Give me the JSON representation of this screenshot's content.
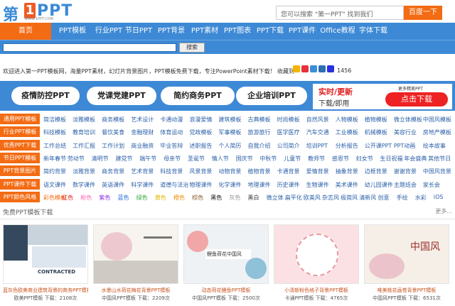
{
  "header": {
    "logo_prefix": "第",
    "logo_num": "1",
    "logo_text": "PPT",
    "logo_url": "WWW.1PPT.COM",
    "search_placeholder": "您可以搜索 \"第一PPT\" 找到我们",
    "search_button": "百度一下"
  },
  "nav": {
    "items": [
      "首页",
      "PPT模板",
      "行业PPT",
      "节日PPT",
      "PPT背景",
      "PPT素材",
      "PPT图表",
      "PPT下载",
      "PPT课件",
      "Office教程",
      "字体下载"
    ]
  },
  "site_search": {
    "button": "搜索"
  },
  "welcome": {
    "text": "欢迎进入第一PPT模板网，海量PPT素材，幻灯片背景图片，PPT模板免费下载，专注PowerPoint素材下载！",
    "share_label": "收藏到",
    "count": "1456"
  },
  "banner": {
    "pills": [
      "疫情防控PPT",
      "党课党建PPT",
      "简约商务PPT",
      "企业培训PPT"
    ],
    "promo_title": "实时/更新",
    "promo_sub": "下载/即用",
    "promo_more": "更多精美PPT",
    "promo_btn": "点击下载"
  },
  "categories": [
    {
      "label": "通用PPT模板",
      "links": [
        "简洁模板",
        "淡雅模板",
        "商务模板",
        "艺术设计",
        "卡通动漫",
        "浪漫爱情",
        "建筑模板",
        "古典模板",
        "时尚模板",
        "自然风景",
        "人物模板",
        "植物模板",
        "微立体模板",
        "中国风模板"
      ]
    },
    {
      "label": "行业PPT模板",
      "links": [
        "科技模板",
        "教育培训",
        "餐饮美食",
        "金融理财",
        "体育运动",
        "党政模板",
        "军事模板",
        "旅游旅行",
        "医学医疗",
        "汽车交通",
        "工业模板",
        "机械模板",
        "美容行业",
        "房地产模板"
      ]
    },
    {
      "label": "优秀PPT下载",
      "links": [
        "工作总结",
        "工作汇报",
        "工作计划",
        "商业融资",
        "毕业答辩",
        "述职报告",
        "个人简历",
        "自我介绍",
        "公司简介",
        "培训PPT",
        "分析报告",
        "公开课PPT",
        "PPT动画",
        "绘本故事"
      ]
    },
    {
      "label": "节日PPT模板",
      "links": [
        "新年春节",
        "劳动节",
        "清明节",
        "建党节",
        "端午节",
        "母亲节",
        "圣诞节",
        "情人节",
        "国庆节",
        "中秋节",
        "儿童节",
        "教师节",
        "感恩节",
        "妇女节",
        "生日祝福",
        "年会盛典",
        "其他节日"
      ]
    },
    {
      "label": "PPT背景图片",
      "links": [
        "简约背景",
        "淡雅背景",
        "商务背景",
        "艺术背景",
        "科技背景",
        "风景背景",
        "动物背景",
        "植物背景",
        "卡通背景",
        "爱情背景",
        "抽象背景",
        "边框背景",
        "谢谢背景",
        "中国风背景"
      ]
    },
    {
      "label": "PPT课件下载",
      "links": [
        "语文课件",
        "数学课件",
        "英语课件",
        "科学课件",
        "道德与法治",
        "物理课件",
        "化学课件",
        "地理课件",
        "历史课件",
        "生物课件",
        "美术课件",
        "幼儿园课件",
        "主题班会",
        "家长会"
      ]
    },
    {
      "label": "PPT颜色风格",
      "links": [
        "彩色模板",
        "红色",
        "粉色",
        "紫色",
        "蓝色",
        "绿色",
        "黄色",
        "橙色",
        "棕色",
        "黑色",
        "灰色",
        "黑白",
        "微立体",
        "扁平化",
        "欧美风",
        "杂志风",
        "极简风",
        "清新风",
        "创意",
        "手绘",
        "水彩",
        "iOS"
      ]
    }
  ],
  "colors": {
    "color_style": [
      "#f36b13",
      "#e11d1d",
      "#ff69b4",
      "#8a2be2",
      "#1e6fd9",
      "#2eaa3c",
      "#e6b800",
      "#f08c00",
      "#8b5a2b",
      "#111111",
      "#999999",
      "#333333",
      "#2a5fa8",
      "#2a5fa8",
      "#2a5fa8",
      "#2a5fa8",
      "#2a5fa8",
      "#2a5fa8",
      "#2a5fa8",
      "#2a5fa8",
      "#2a5fa8",
      "#2a5fa8"
    ]
  },
  "free_section": {
    "title": "免费PPT模板下载",
    "more": "更多..."
  },
  "cards": [
    {
      "caption": "蓝灰色欧美商业建筑背景的商务PPT模板",
      "category": "欧美PPT模板",
      "downloads": "下载：2108次",
      "thumb_text": "CONTRACTED"
    },
    {
      "caption": "水墨山水荷花梅花背景PPT模板",
      "category": "中国风PPT模板",
      "downloads": "下载：2209次",
      "thumb_text": ""
    },
    {
      "caption": "动态荷花鲤鱼PPT模板",
      "category": "中国风PPT模板",
      "downloads": "下载：2500次",
      "thumb_text": "鲤鱼荷花中国风"
    },
    {
      "caption": "小清新粉色格子背景PPT模板",
      "category": "卡通PPT模板",
      "downloads": "下载：4765次",
      "thumb_text": ""
    },
    {
      "caption": "唯美桃花画卷背景PPT模板",
      "category": "中国风PPT模板",
      "downloads": "下载：6531次",
      "thumb_text": "中国风"
    }
  ]
}
